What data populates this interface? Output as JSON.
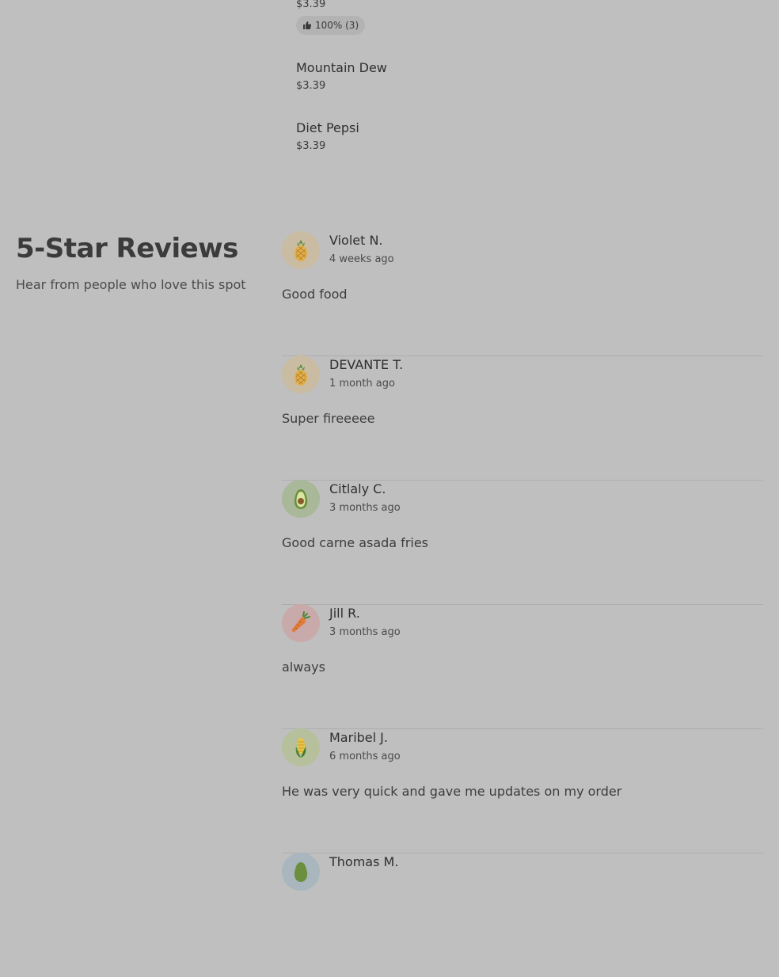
{
  "menu": {
    "items": [
      {
        "name": "",
        "price": "$3.39",
        "rating": "100% (3)"
      },
      {
        "name": "Mountain Dew",
        "price": "$3.39"
      },
      {
        "name": "Diet Pepsi",
        "price": "$3.39"
      }
    ]
  },
  "reviews_section": {
    "title": "5-Star Reviews",
    "subtitle": "Hear from people who love this spot",
    "reviews": [
      {
        "name": "Violet N.",
        "date": "4 weeks ago",
        "text": "Good food",
        "avatar_icon": "pineapple-icon",
        "avatar_color": "#c9bca3"
      },
      {
        "name": "DEVANTE T.",
        "date": "1 month ago",
        "text": "Super fireeeee",
        "avatar_icon": "pineapple-icon",
        "avatar_color": "#c9bca3"
      },
      {
        "name": "Citlaly C.",
        "date": "3 months ago",
        "text": "Good carne asada fries",
        "avatar_icon": "avocado-icon",
        "avatar_color": "#a8b898"
      },
      {
        "name": "Jill R.",
        "date": "3 months ago",
        "text": "always",
        "avatar_icon": "carrot-icon",
        "avatar_color": "#c9aaaa"
      },
      {
        "name": "Maribel J.",
        "date": "6 months ago",
        "text": "He was very quick and gave me updates on my order",
        "avatar_icon": "corn-icon",
        "avatar_color": "#b7c09c"
      },
      {
        "name": "Thomas M.",
        "date": "",
        "text": "",
        "avatar_icon": "avocado-icon",
        "avatar_color": "#a9b6bd"
      }
    ]
  }
}
